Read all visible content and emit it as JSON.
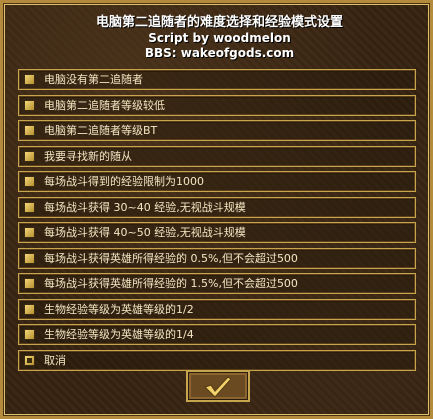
{
  "header": {
    "title": "电脑第二追随者的难度选择和经验模式设置",
    "credit": "Script by woodmelon",
    "bbs": "BBS: wakeofgods.com"
  },
  "options": [
    {
      "label": "电脑没有第二追随者",
      "checked": false
    },
    {
      "label": "电脑第二追随者等级较低",
      "checked": false
    },
    {
      "label": "电脑第二追随者等级BT",
      "checked": false
    },
    {
      "label": "我要寻找新的随从",
      "checked": false
    },
    {
      "label": "每场战斗得到的经验限制为1000",
      "checked": false
    },
    {
      "label": "每场战斗获得 30~40 经验,无视战斗规模",
      "checked": false
    },
    {
      "label": "每场战斗获得 40~50 经验,无视战斗规模",
      "checked": false
    },
    {
      "label": "每场战斗获得英雄所得经验的 0.5%,但不会超过500",
      "checked": false
    },
    {
      "label": "每场战斗获得英雄所得经验的 1.5%,但不会超过500",
      "checked": false
    },
    {
      "label": "生物经验等级为英雄等级的1/2",
      "checked": false
    },
    {
      "label": "生物经验等级为英雄等级的1/4",
      "checked": false
    },
    {
      "label": "取消",
      "checked": true
    }
  ],
  "ok_icon": "checkmark-icon",
  "colors": {
    "border": "#c7a44e",
    "text": "#f3e7c2",
    "check": "#e8c65c"
  }
}
